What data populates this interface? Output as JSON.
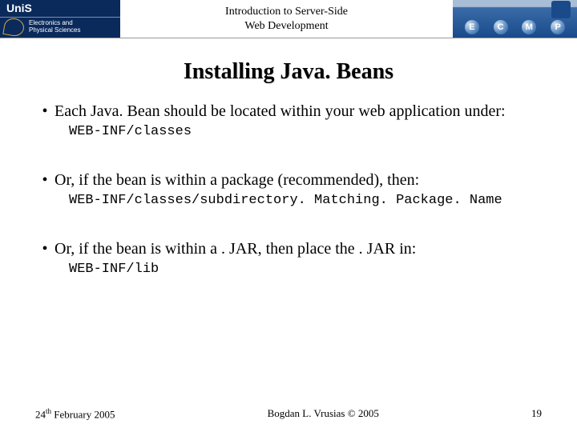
{
  "header": {
    "logo_left_brand": "UniS",
    "logo_left_dept_line1": "Electronics and",
    "logo_left_dept_line2": "Physical Sciences",
    "title_line1": "Introduction to Server-Side",
    "title_line2": "Web Development",
    "logo_right_letters": [
      "E",
      "C",
      "M",
      "P"
    ]
  },
  "slide": {
    "title": "Installing Java. Beans",
    "bullets": [
      {
        "text": "Each Java. Bean should be located within your web application under:",
        "code": "WEB-INF/classes"
      },
      {
        "text": "Or, if the bean is within a package (recommended), then:",
        "code": "WEB-INF/classes/subdirectory. Matching. Package. Name"
      },
      {
        "text": "Or, if the bean is within  a . JAR, then place the . JAR in:",
        "code": "WEB-INF/lib"
      }
    ]
  },
  "footer": {
    "date_day": "24",
    "date_ord": "th",
    "date_rest": " February 2005",
    "author": "Bogdan L. Vrusias © 2005",
    "page": "19"
  }
}
